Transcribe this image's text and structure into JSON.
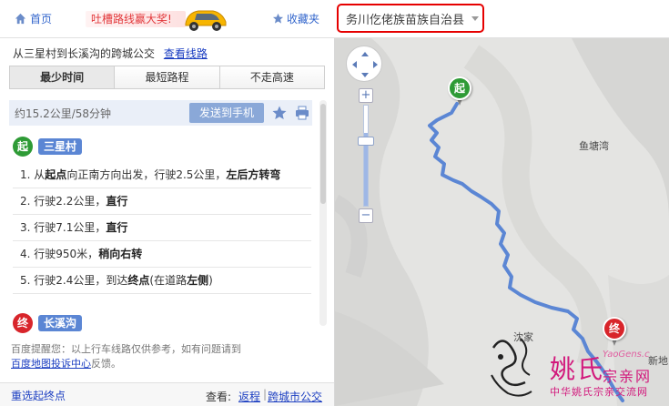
{
  "topbar": {
    "home_label": "首页",
    "ad_text": "吐槽路线赢大奖!",
    "favorites_label": "收藏夹",
    "city": "务川仡佬族苗族自治县"
  },
  "panel": {
    "summary_text": "从三星村到长溪沟的跨城公交",
    "view_route_link": "查看线路",
    "tabs": [
      {
        "label": "最少时间",
        "active": true
      },
      {
        "label": "最短路程",
        "active": false
      },
      {
        "label": "不走高速",
        "active": false
      }
    ],
    "distance_time": "约15.2公里/58分钟",
    "send_to_phone": "发送到手机",
    "start": {
      "badge": "起",
      "name": "三星村"
    },
    "end": {
      "badge": "终",
      "name": "长溪沟"
    },
    "steps": [
      {
        "num": "1.",
        "pre": "从",
        "b1": "起点",
        "mid": "向正南方向出发，行驶2.5公里，",
        "b2": "左后方转弯",
        "post": ""
      },
      {
        "num": "2.",
        "pre": "行驶2.2公里，",
        "b1": "直行",
        "mid": "",
        "b2": "",
        "post": ""
      },
      {
        "num": "3.",
        "pre": "行驶7.1公里，",
        "b1": "直行",
        "mid": "",
        "b2": "",
        "post": ""
      },
      {
        "num": "4.",
        "pre": "行驶950米，",
        "b1": "稍向右转",
        "mid": "",
        "b2": "",
        "post": ""
      },
      {
        "num": "5.",
        "pre": "行驶2.4公里，到达",
        "b1": "终点",
        "mid": "(在道路",
        "b2": "左侧",
        "post": ")"
      }
    ],
    "notice_text": "百度提醒您：以上行车线路仅供参考，如有问题请到",
    "notice_link": "百度地图投诉中心",
    "notice_tail": "反馈。"
  },
  "footer": {
    "reset": "重选起终点",
    "view_label": "查看:",
    "return_link": "返程",
    "separator": "|",
    "intercity_link": "跨城市公交"
  },
  "map": {
    "zoom_in": "+",
    "zoom_out": "−",
    "labels": {
      "yutangwan": "鱼塘湾",
      "shenjia": "沈家",
      "edge": "新地"
    },
    "start_marker": "起",
    "end_marker": "终",
    "route_color": "#5b86d4"
  },
  "watermark": {
    "title": "姚氏",
    "subtitle_a": "宗亲网",
    "domain": "YaoGens.c",
    "sub": "中华姚氏宗亲交流网"
  },
  "colors": {
    "link": "#1a3dc1",
    "start_green": "#2e9b36",
    "end_red": "#d8252b",
    "highlight_border": "#e60000"
  }
}
